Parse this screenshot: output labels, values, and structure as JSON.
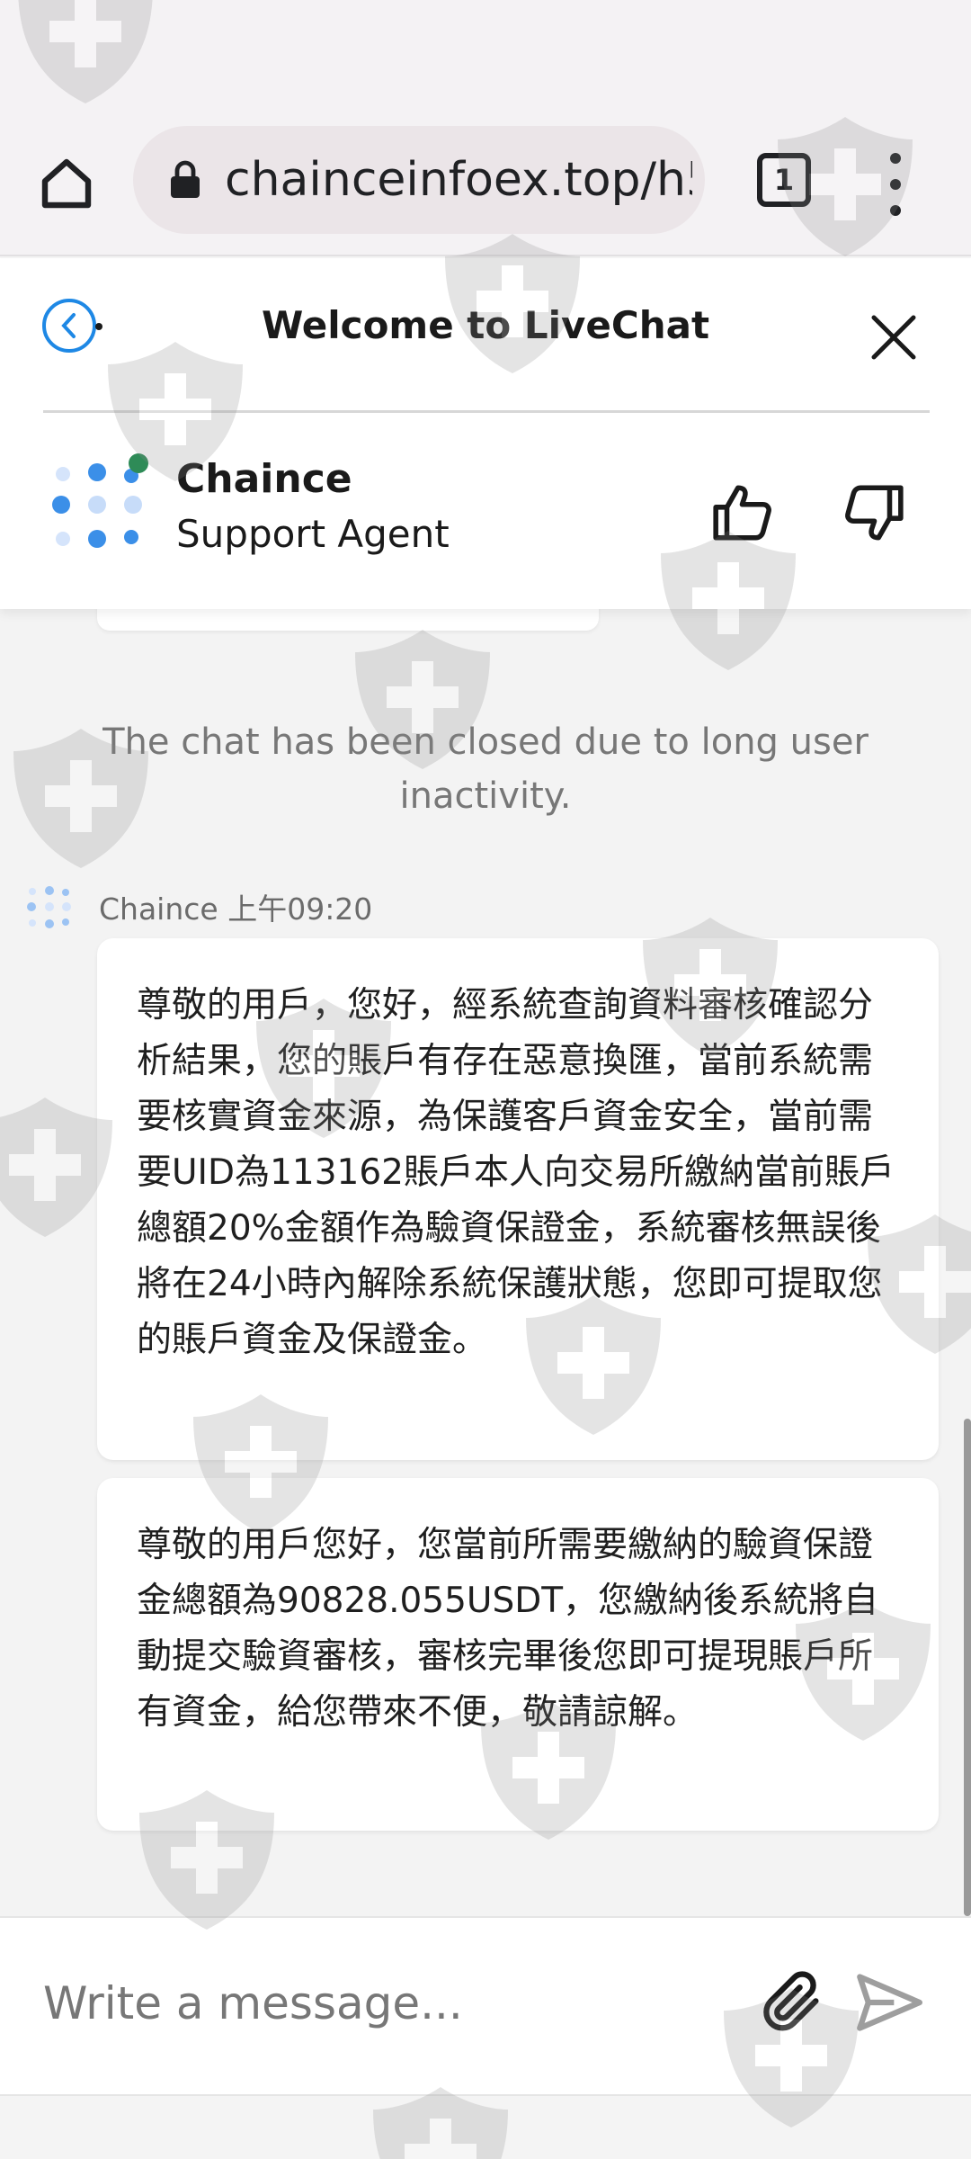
{
  "browser": {
    "url": "chainceinfoex.top/h5",
    "tab_count": "1"
  },
  "chat_header": {
    "title": "Welcome to LiveChat",
    "agent_name": "Chaince",
    "agent_role": "Support Agent"
  },
  "chat": {
    "system_message": "The chat has been closed due to long user inactivity.",
    "sender": "Chaince 上午09:20",
    "messages": [
      "尊敬的用戶，您好，經系統查詢資料審核確認分析結果，您的賬戶有存在惡意換匯，當前系統需要核實資金來源，為保護客戶資金安全，當前需要UID為113162賬戶本人向交易所繳納當前賬戶總額20%金額作為驗資保證金，系統審核無誤後將在24小時內解除系統保護狀態，您即可提取您的賬戶資金及保證金。",
      "尊敬的用戶您好，您當前所需要繳納的驗資保證金總額為90828.055USDT，您繳納後系統將自動提交驗資審核，審核完畢後您即可提現賬戶所有資金，給您帶來不便，敬請諒解。"
    ]
  },
  "composer": {
    "placeholder": "Write a message..."
  },
  "icons": {
    "home": "home-icon",
    "lock": "lock-icon",
    "tabs": "tabs-icon",
    "menu": "more-vert-icon",
    "back": "back-icon",
    "close": "close-icon",
    "thumbs_up": "thumbs-up-icon",
    "thumbs_down": "thumbs-down-icon",
    "attach": "paperclip-icon",
    "send": "send-icon",
    "watermark": "shield-cross-icon"
  },
  "colors": {
    "accent_blue": "#1e88e5",
    "online_green": "#2e8b57",
    "chat_bg": "#f3f3f3",
    "bubble_bg": "#ffffff"
  }
}
